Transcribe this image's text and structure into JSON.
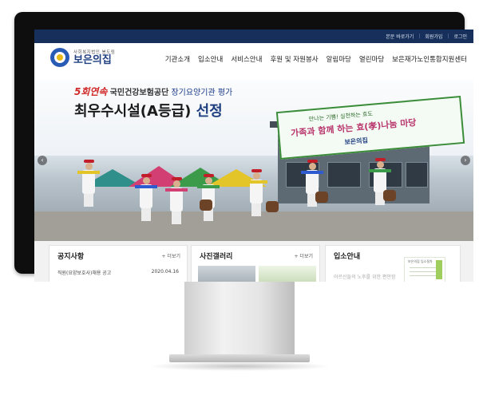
{
  "topbar": {
    "links": [
      "본문 바로가기",
      "회원가입",
      "로그인"
    ]
  },
  "header": {
    "logo_sub": "사회복지법인 봉도림",
    "logo_name": "보은의집"
  },
  "nav": {
    "items": [
      "기관소개",
      "입소안내",
      "서비스안내",
      "후원 및 자원봉사",
      "알림마당",
      "열린마당",
      "보은재가노인통합지원센터"
    ]
  },
  "hero": {
    "line1_highlight": "5회연속",
    "line1_agency": "국민건강보험공단",
    "line1_rest": "장기요양기관 평가",
    "line2_main": "최우수시설(A등급)",
    "line2_accent": "선정",
    "banner_line1": "만나는 기쁨! 실천하는 효도",
    "banner_line2": "가족과 함께 하는 효(孝)나눔 마당",
    "banner_logo": "보은의집",
    "prev_arrow": "‹",
    "next_arrow": "›"
  },
  "panels": {
    "notice": {
      "title": "공지사항",
      "more": "+ 더보기",
      "item_title": "직원(요양보호사)채용 공고",
      "item_date": "2020.04.16"
    },
    "gallery": {
      "title": "사진갤러리",
      "more": "+ 더보기"
    },
    "admission": {
      "title": "입소안내",
      "text": "어르신들의 노후를 위한 편안함",
      "deco_label": "보은의집 입소절차"
    }
  },
  "colors": {
    "topbar": "#16305b",
    "brand_blue": "#1f3f80",
    "accent_red": "#d12a2a"
  }
}
